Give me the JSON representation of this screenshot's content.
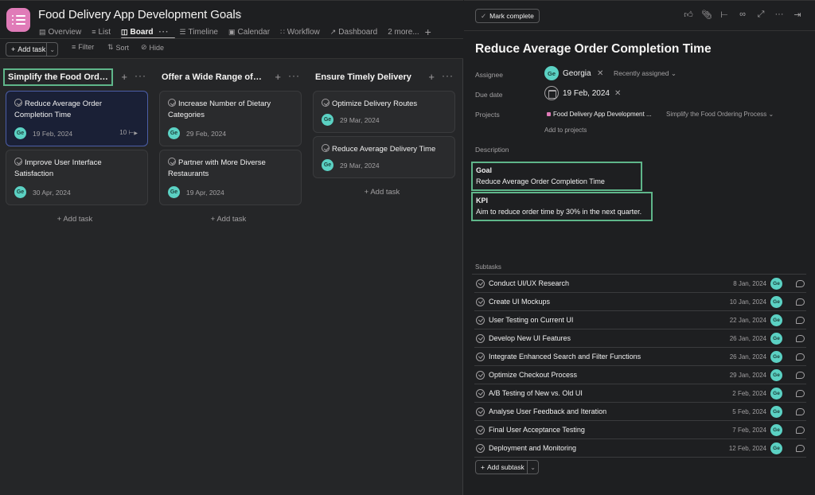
{
  "project": {
    "title": "Food Delivery App Development Goals",
    "icon": "list-icon",
    "color": "#e07bb8"
  },
  "tabs": [
    {
      "label": "Overview",
      "icon": "clipboard-icon",
      "active": false
    },
    {
      "label": "List",
      "icon": "list-icon",
      "active": false
    },
    {
      "label": "Board",
      "icon": "board-icon",
      "active": true
    },
    {
      "label": "Timeline",
      "icon": "timeline-icon",
      "active": false
    },
    {
      "label": "Calendar",
      "icon": "calendar-icon",
      "active": false
    },
    {
      "label": "Workflow",
      "icon": "workflow-icon",
      "active": false
    },
    {
      "label": "Dashboard",
      "icon": "dashboard-icon",
      "active": false
    },
    {
      "label": "2 more...",
      "icon": "",
      "active": false
    }
  ],
  "toolbar": {
    "add_task": "Add task",
    "filter": "Filter",
    "sort": "Sort",
    "hide": "Hide"
  },
  "columns": [
    {
      "title": "Simplify the Food Ordering ...",
      "highlighted": true,
      "add_task": "+ Add task",
      "cards": [
        {
          "title": "Reduce Average Order Completion Time",
          "assignee": "Ge",
          "date": "19 Feb, 2024",
          "subtasks": "10",
          "selected": true
        },
        {
          "title": "Improve User Interface Satisfaction",
          "assignee": "Ge",
          "date": "30 Apr, 2024",
          "subtasks": "",
          "selected": false
        }
      ]
    },
    {
      "title": "Offer a Wide Range of Dieta...",
      "highlighted": false,
      "add_task": "+ Add task",
      "cards": [
        {
          "title": "Increase Number of Dietary Categories",
          "assignee": "Ge",
          "date": "29 Feb, 2024",
          "subtasks": "",
          "selected": false
        },
        {
          "title": "Partner with More Diverse Restaurants",
          "assignee": "Ge",
          "date": "19 Apr, 2024",
          "subtasks": "",
          "selected": false
        }
      ]
    },
    {
      "title": "Ensure Timely Delivery",
      "highlighted": false,
      "add_task": "+ Add task",
      "cards": [
        {
          "title": "Optimize Delivery Routes",
          "assignee": "Ge",
          "date": "29 Mar, 2024",
          "subtasks": "",
          "selected": false
        },
        {
          "title": "Reduce Average Delivery Time",
          "assignee": "Ge",
          "date": "29 Mar, 2024",
          "subtasks": "",
          "selected": false
        }
      ]
    }
  ],
  "detail": {
    "mark_complete": "Mark complete",
    "header_icons": [
      "like-icon",
      "attachment-icon",
      "subtask-icon",
      "link-icon",
      "expand-icon",
      "more-icon",
      "close-pane-icon"
    ],
    "title": "Reduce Average Order Completion Time",
    "assignee_label": "Assignee",
    "assignee_initials": "Ge",
    "assignee_name": "Georgia",
    "recently_assigned": "Recently assigned",
    "due_label": "Due date",
    "due_value": "19 Feb, 2024",
    "projects_label": "Projects",
    "project_name": "Food Delivery App Development ...",
    "project_section": "Simplify the Food Ordering Process",
    "add_to_projects": "Add to projects",
    "description_label": "Description",
    "goal_heading": "Goal",
    "goal_text": "Reduce Average Order Completion Time",
    "kpi_heading": "KPI",
    "kpi_text": "Aim to reduce order time by 30% in the next quarter.",
    "subtasks_label": "Subtasks",
    "subtasks": [
      {
        "name": "Conduct UI/UX Research",
        "date": "8 Jan, 2024",
        "assignee": "Ge"
      },
      {
        "name": "Create UI Mockups",
        "date": "10 Jan, 2024",
        "assignee": "Ge"
      },
      {
        "name": "User Testing on Current UI",
        "date": "22 Jan, 2024",
        "assignee": "Ge"
      },
      {
        "name": "Develop New UI Features",
        "date": "26 Jan, 2024",
        "assignee": "Ge"
      },
      {
        "name": "Integrate Enhanced Search and Filter Functions",
        "date": "26 Jan, 2024",
        "assignee": "Ge"
      },
      {
        "name": "Optimize Checkout Process",
        "date": "29 Jan, 2024",
        "assignee": "Ge"
      },
      {
        "name": "A/B Testing of New vs. Old UI",
        "date": "2 Feb, 2024",
        "assignee": "Ge"
      },
      {
        "name": "Analyse User Feedback and Iteration",
        "date": "5 Feb, 2024",
        "assignee": "Ge"
      },
      {
        "name": "Final User Acceptance Testing",
        "date": "7 Feb, 2024",
        "assignee": "Ge"
      },
      {
        "name": "Deployment and Monitoring",
        "date": "12 Feb, 2024",
        "assignee": "Ge"
      }
    ],
    "add_subtask": "Add subtask"
  }
}
